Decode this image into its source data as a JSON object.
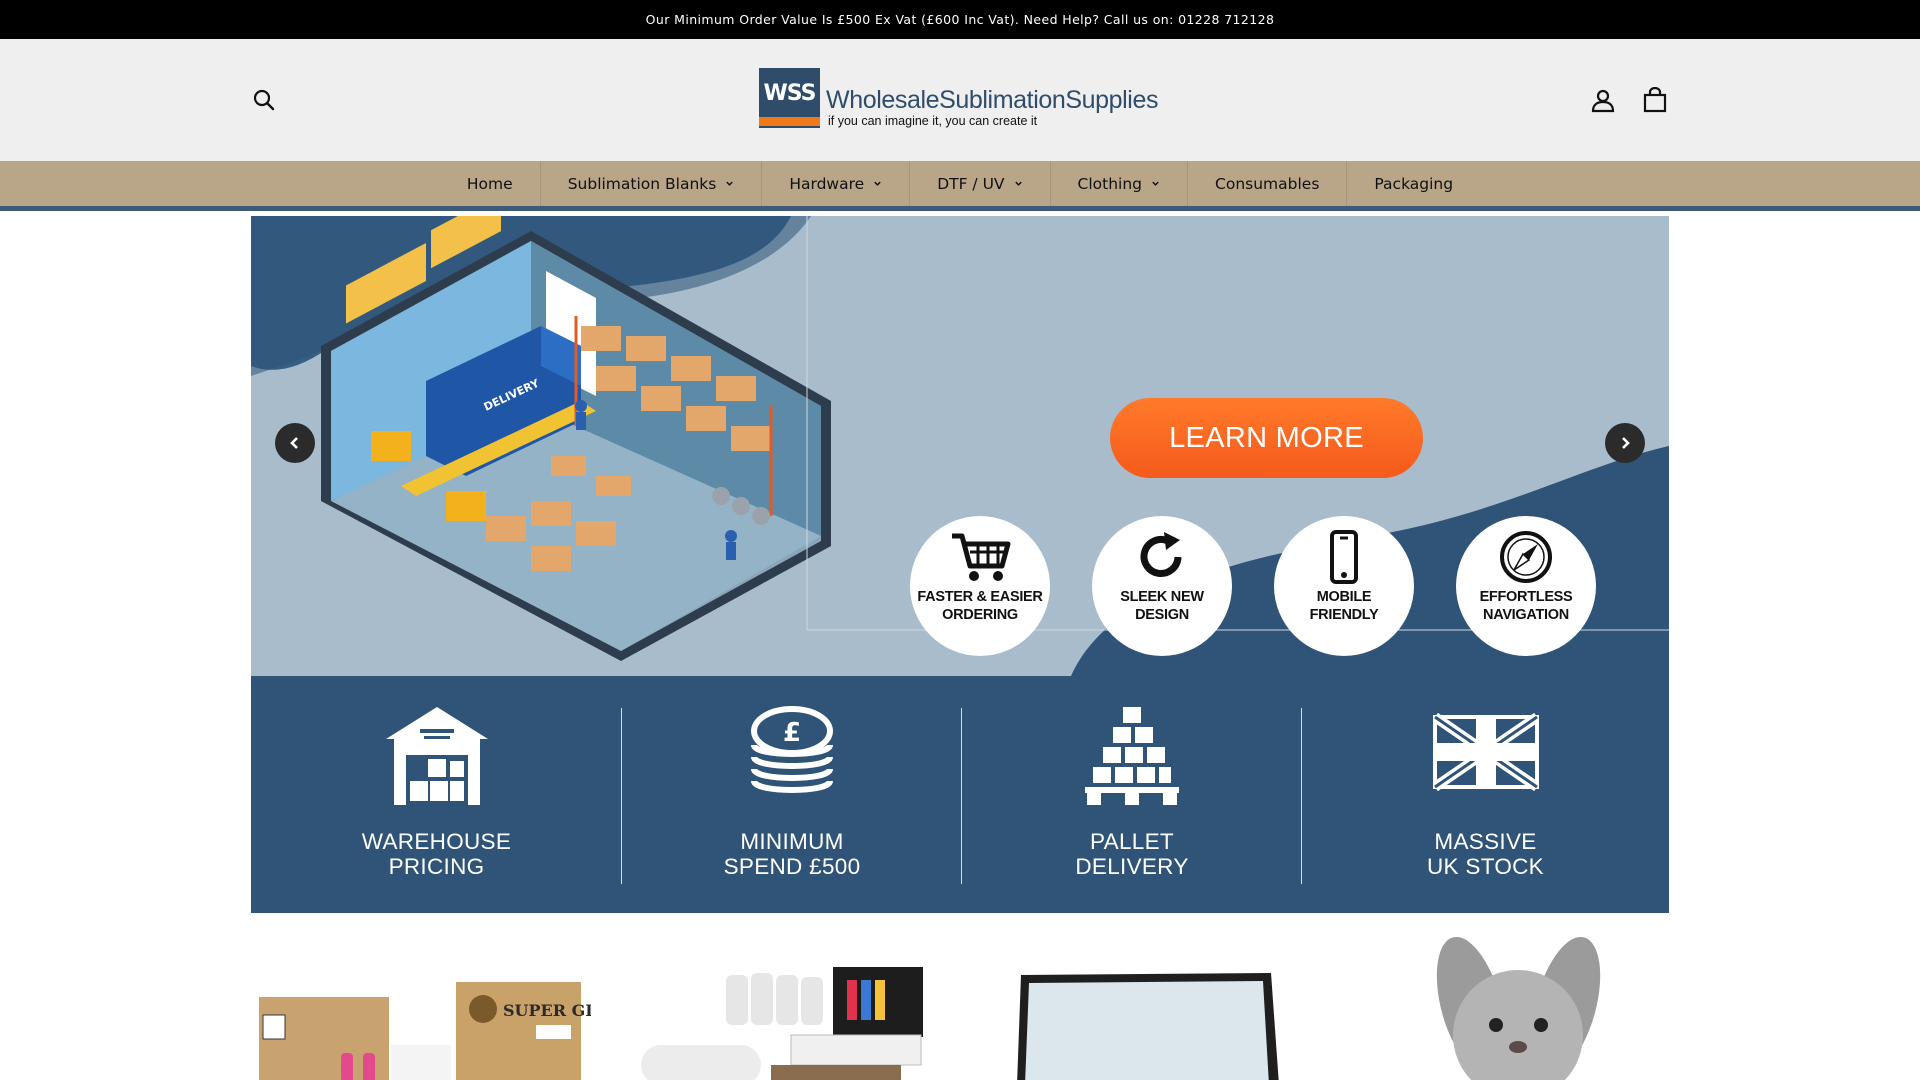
{
  "announcement": "Our Minimum Order Value Is £500 Ex Vat (£600 Inc Vat). Need Help? Call us on: 01228 712128",
  "header": {
    "logo_badge": "WSS",
    "logo_name": "WholesaleSublimationSupplies",
    "logo_tagline": "if you can imagine it, you can create it",
    "icons": [
      "search-icon",
      "account-icon",
      "cart-icon"
    ]
  },
  "nav": {
    "items": [
      {
        "label": "Home",
        "dropdown": false
      },
      {
        "label": "Sublimation Blanks",
        "dropdown": true
      },
      {
        "label": "Hardware",
        "dropdown": true
      },
      {
        "label": "DTF / UV",
        "dropdown": true
      },
      {
        "label": "Clothing",
        "dropdown": true
      },
      {
        "label": "Consumables",
        "dropdown": false
      },
      {
        "label": "Packaging",
        "dropdown": false
      }
    ]
  },
  "hero": {
    "cta_label": "LEARN MORE",
    "delivery_text": "DELIVERY",
    "features": [
      {
        "icon": "cart-icon",
        "label_line1": "FASTER & EASIER",
        "label_line2": "ORDERING"
      },
      {
        "icon": "refresh-icon",
        "label_line1": "SLEEK NEW",
        "label_line2": "DESIGN"
      },
      {
        "icon": "smartphone-icon",
        "label_line1": "MOBILE",
        "label_line2": "FRIENDLY"
      },
      {
        "icon": "compass-icon",
        "label_line1": "EFFORTLESS",
        "label_line2": "NAVIGATION"
      }
    ]
  },
  "benefits": [
    {
      "icon": "warehouse-icon",
      "line1": "WAREHOUSE",
      "line2": "PRICING"
    },
    {
      "icon": "coins-icon",
      "line1": "MINIMUM",
      "line2": "SPEND £500"
    },
    {
      "icon": "pallet-icon",
      "line1": "PALLET",
      "line2": "DELIVERY"
    },
    {
      "icon": "union-flag-icon",
      "line1": "MASSIVE",
      "line2": "UK STOCK"
    }
  ],
  "products": {
    "box_brand": "SUPER GLAZE"
  },
  "colors": {
    "announce_bg": "#000000",
    "header_bg": "#efefef",
    "nav_bg": "#b9a588",
    "brand_navy": "#2f5478",
    "cta_orange": "#f96a22",
    "hero_bg": "#a9bccb"
  }
}
